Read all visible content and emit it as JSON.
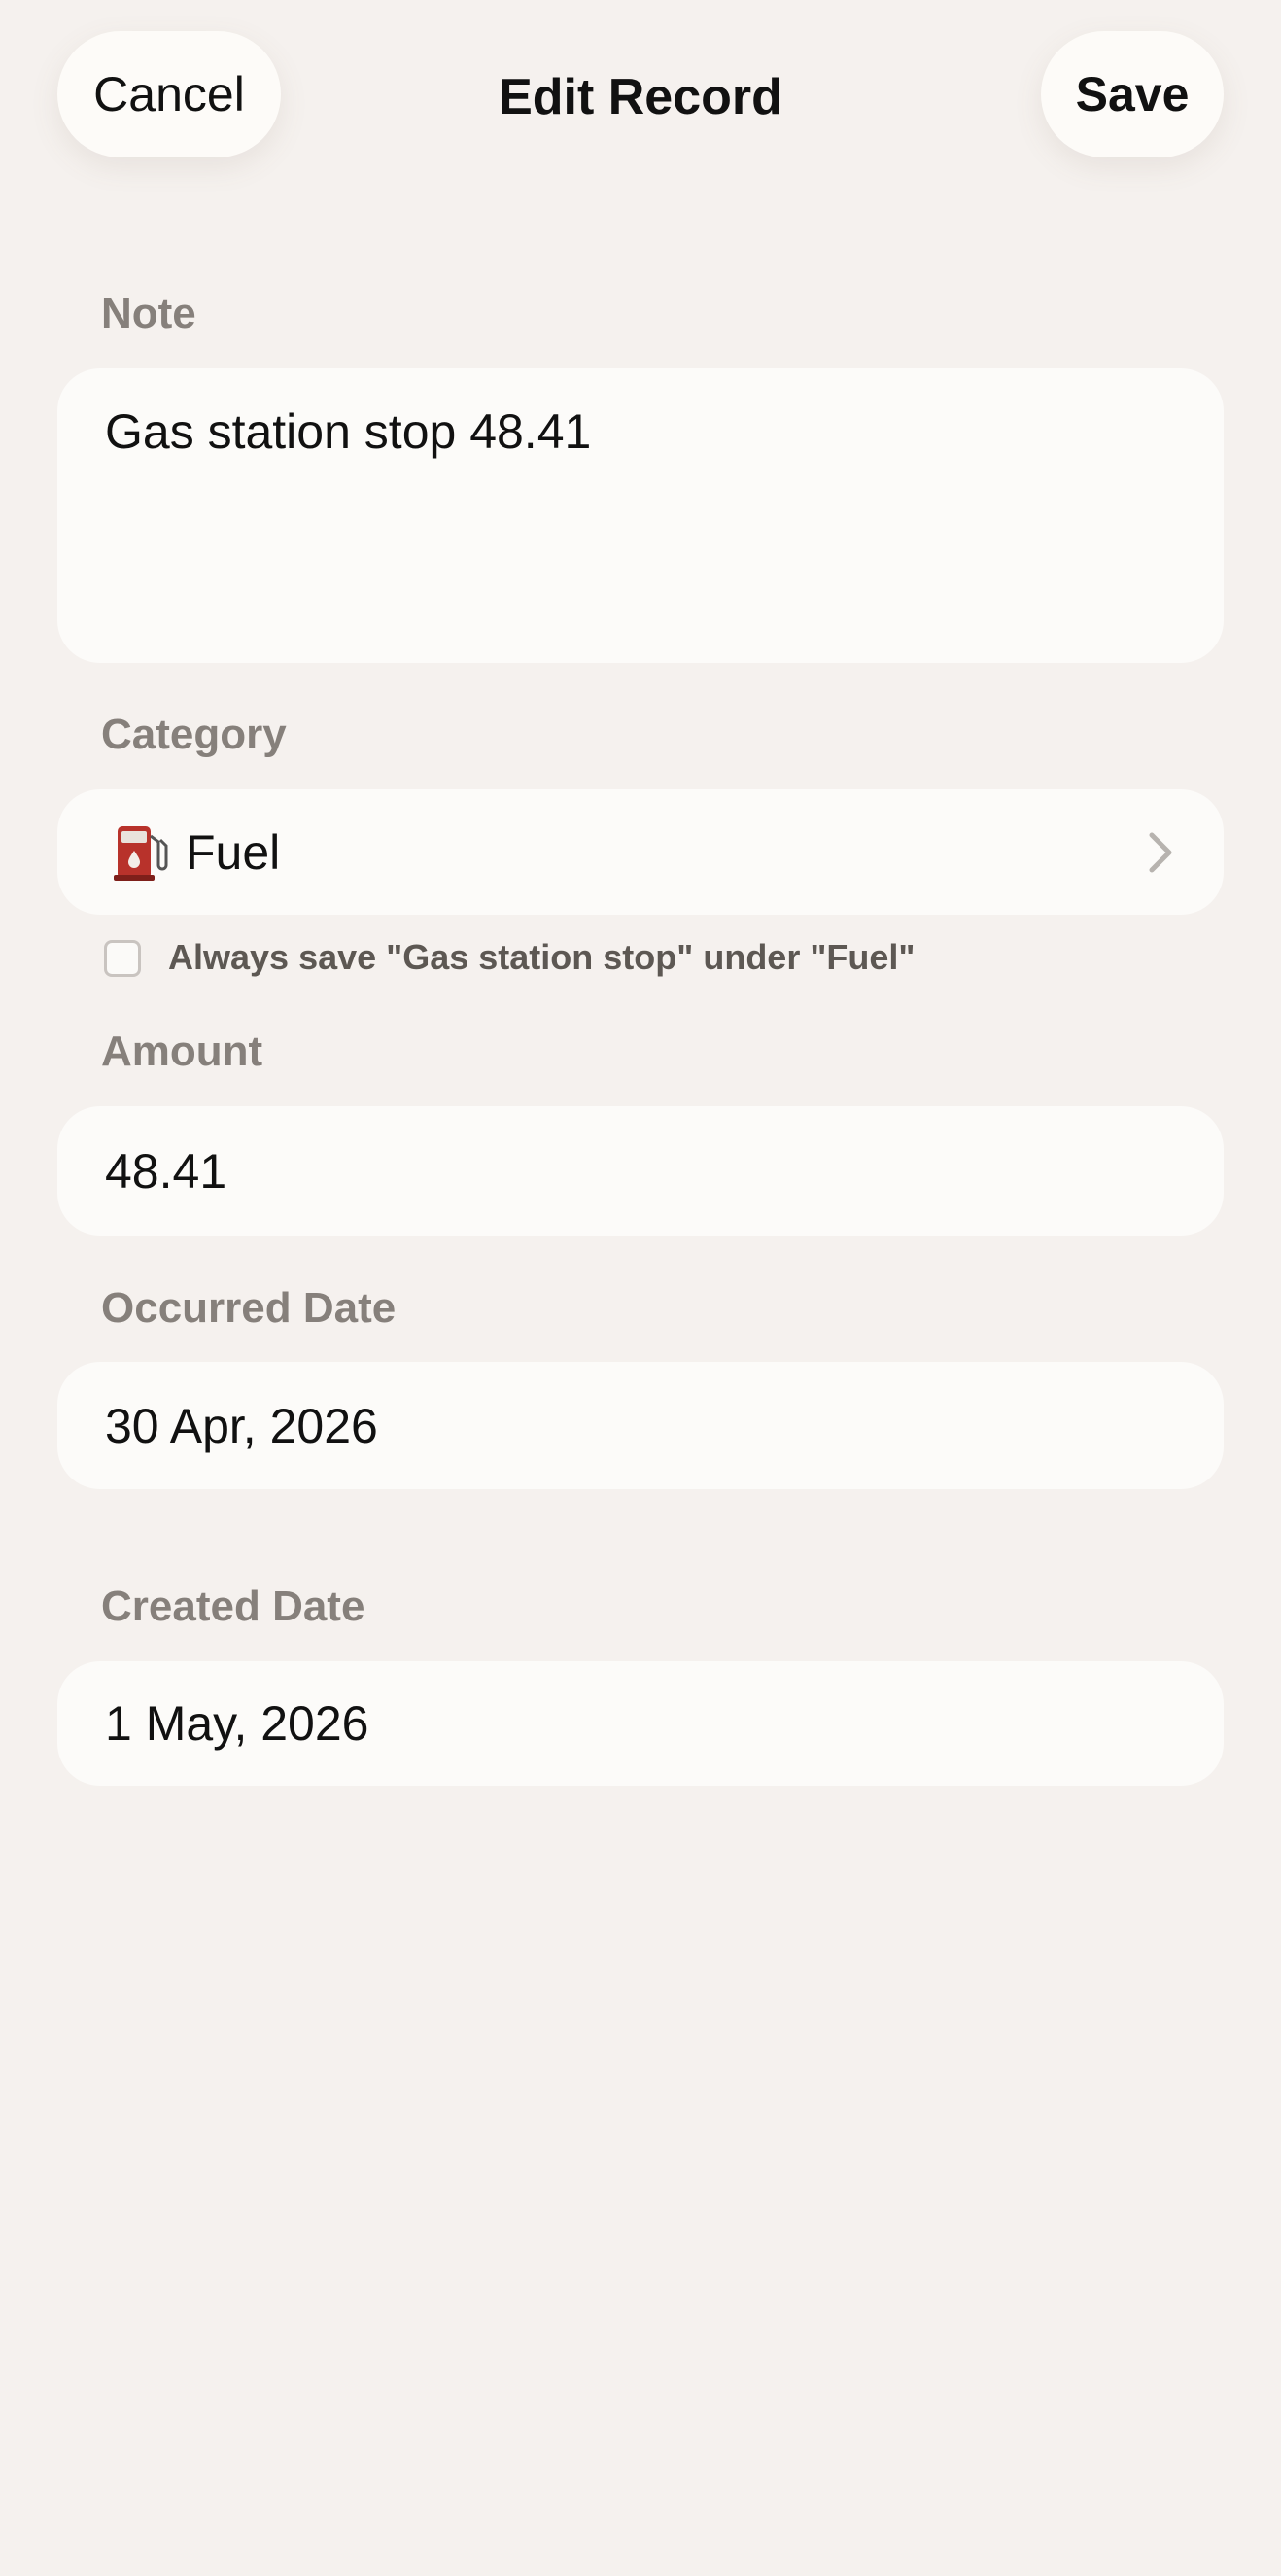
{
  "header": {
    "cancel_label": "Cancel",
    "title": "Edit Record",
    "save_label": "Save"
  },
  "note": {
    "label": "Note",
    "value": "Gas station stop 48.41"
  },
  "category": {
    "label": "Category",
    "icon": "fuel-pump-icon",
    "value": "Fuel",
    "always_save_label": "Always save \"Gas station stop\" under \"Fuel\"",
    "always_save_checked": false
  },
  "amount": {
    "label": "Amount",
    "value": "48.41"
  },
  "occurred_date": {
    "label": "Occurred Date",
    "value": "30 Apr, 2026"
  },
  "created_date": {
    "label": "Created Date",
    "value": "1 May, 2026"
  },
  "colors": {
    "background": "#f5f1ee",
    "field_background": "#fcfbf9",
    "label_text": "#86807b",
    "fuel_icon": "#b8322b"
  }
}
